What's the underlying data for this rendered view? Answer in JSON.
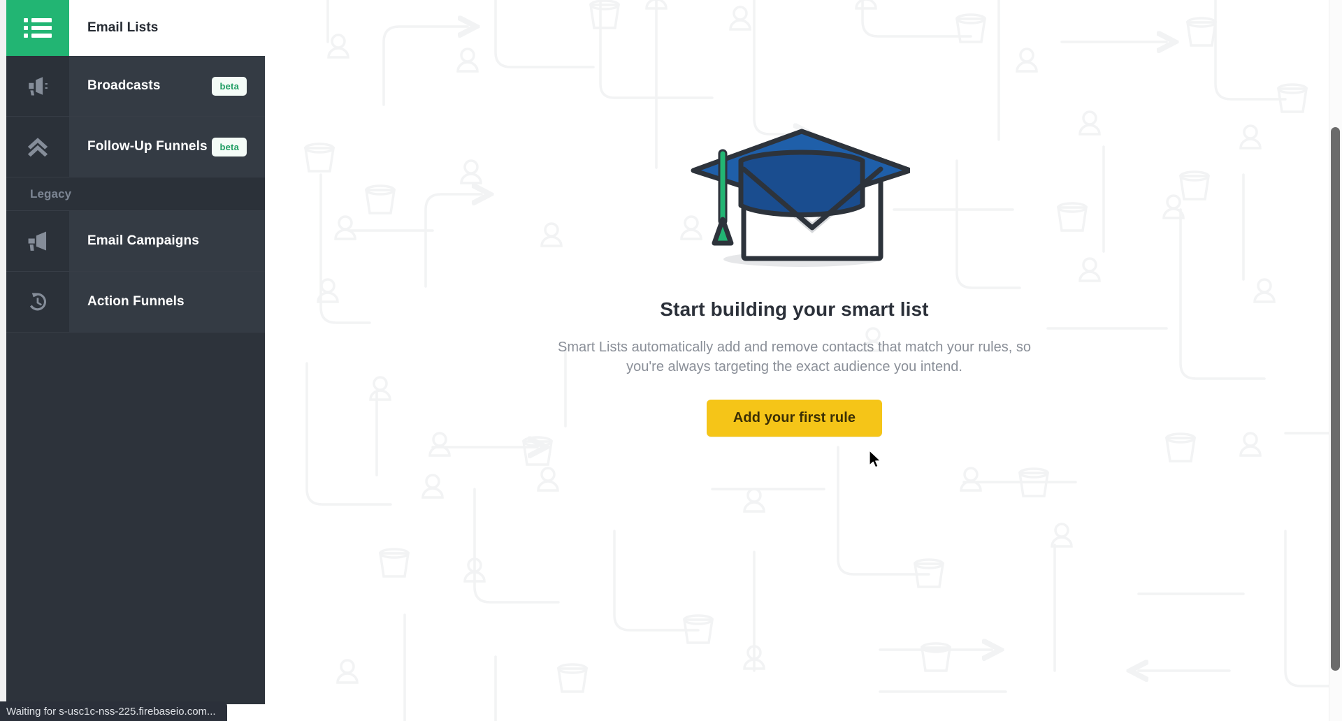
{
  "sidebar": {
    "header": {
      "title": "Email Lists",
      "menu_icon": "list-menu-icon"
    },
    "items": [
      {
        "label": "Broadcasts",
        "badge": "beta",
        "icon": "megaphone-outline-icon"
      },
      {
        "label": "Follow-Up Funnels",
        "badge": "beta",
        "icon": "double-chevron-up-icon"
      }
    ],
    "section_label": "Legacy",
    "legacy_items": [
      {
        "label": "Email Campaigns",
        "badge": "",
        "icon": "megaphone-icon"
      },
      {
        "label": "Action Funnels",
        "badge": "",
        "icon": "history-clock-icon"
      }
    ]
  },
  "main": {
    "illustration": "graduation-cap-envelope-illustration",
    "title": "Start building your smart list",
    "description": "Smart Lists automatically add and remove contacts that match your rules, so you're always targeting the exact audience you intend.",
    "cta_label": "Add your first rule"
  },
  "status_bar": {
    "text": "Waiting for s-usc1c-nss-225.firebaseio.com..."
  },
  "colors": {
    "accent_green": "#22b573",
    "sidebar_bg": "#2d333b",
    "sidebar_item_bg": "#343b44",
    "cta_yellow": "#f5c518",
    "cta_text": "#3b2f05",
    "badge_green_text": "#1f9d63",
    "title_dark": "#2b3039",
    "body_gray": "#8a8f98",
    "cap_blue": "#1f5fa9",
    "cap_blue_dark": "#1a4d8f",
    "tassel_green": "#22b573",
    "envelope_outline": "#2d333b"
  },
  "scrollbar": {
    "position_label": "vertical-scrollbar"
  }
}
